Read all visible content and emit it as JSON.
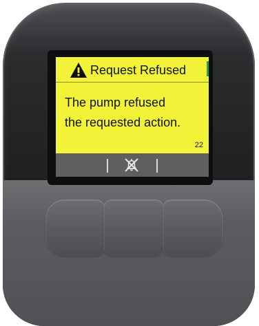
{
  "alert": {
    "title": "Request Refused",
    "message_lines": [
      "The pump refused",
      "the requested action."
    ],
    "code": "22",
    "icon": "warning-triangle-icon",
    "background_color": "#f2f238"
  },
  "softkeys": {
    "center_icon": "alarm-off-icon"
  },
  "hardware_buttons": [
    "left-button",
    "center-button",
    "right-button"
  ]
}
